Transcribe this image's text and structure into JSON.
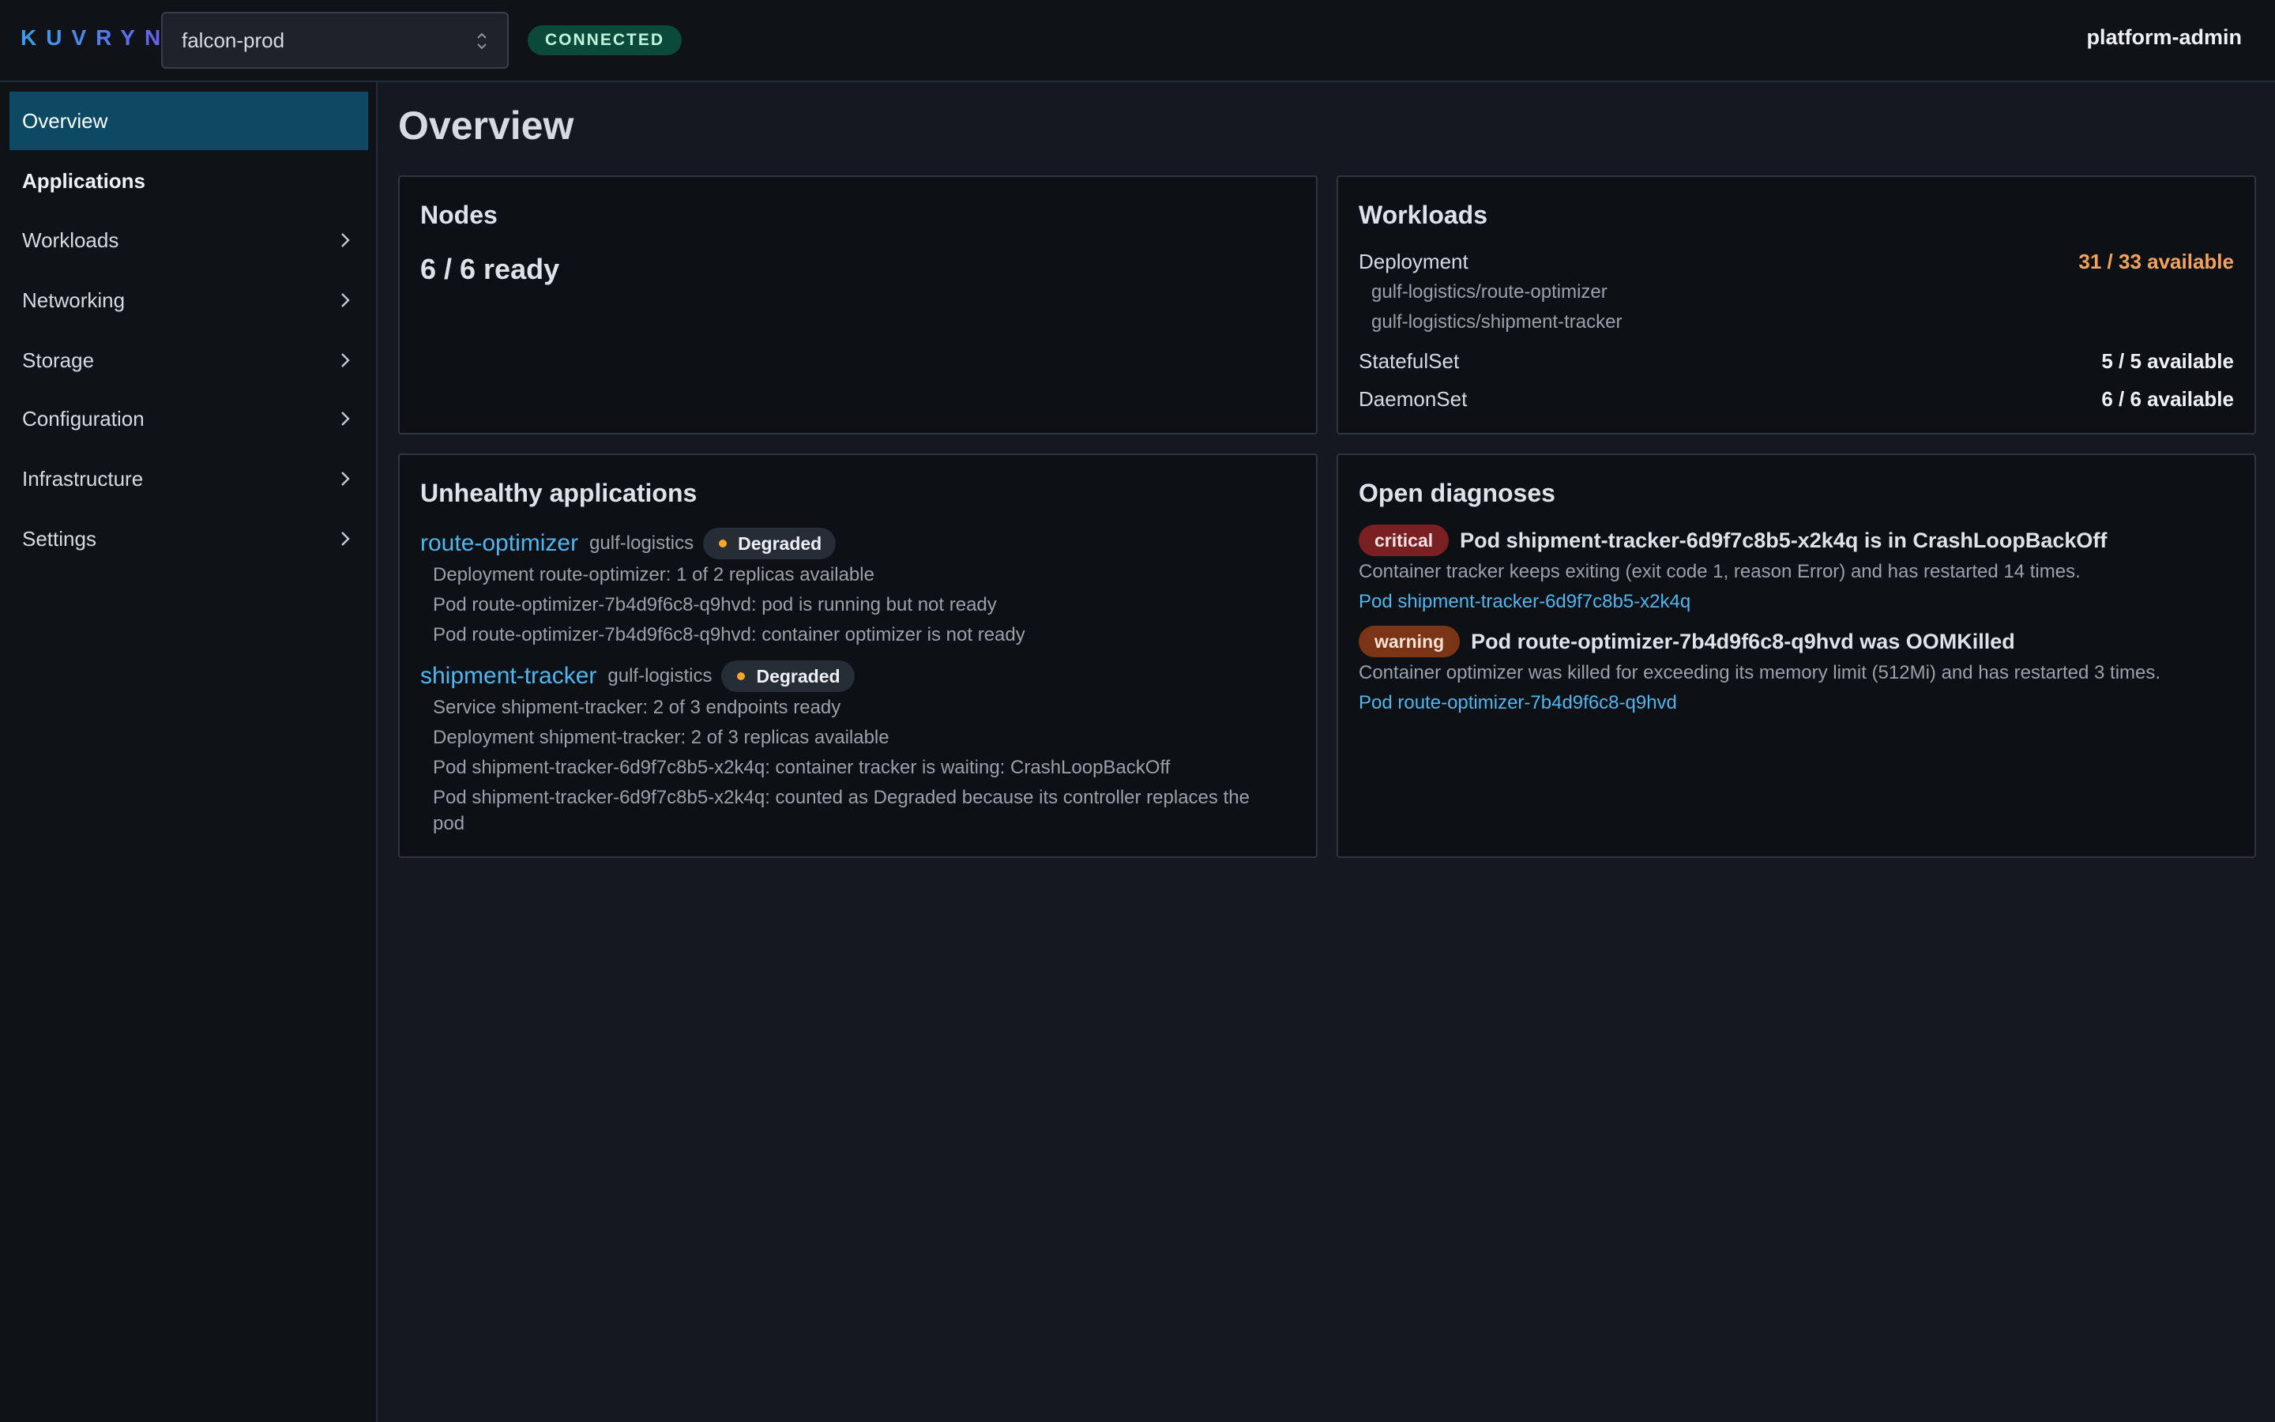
{
  "header": {
    "logo": "KUVRYN",
    "cluster": "falcon-prod",
    "status": "CONNECTED",
    "user": "platform-admin"
  },
  "sidebar": {
    "items": [
      {
        "label": "Overview"
      },
      {
        "label": "Applications"
      },
      {
        "label": "Workloads"
      },
      {
        "label": "Networking"
      },
      {
        "label": "Storage"
      },
      {
        "label": "Configuration"
      },
      {
        "label": "Infrastructure"
      },
      {
        "label": "Settings"
      }
    ]
  },
  "main": {
    "title": "Overview",
    "nodes": {
      "title": "Nodes",
      "stat": "6 / 6 ready"
    },
    "workloads": {
      "title": "Workloads",
      "rows": [
        {
          "kind": "Deployment",
          "value": "31 / 33 available"
        },
        {
          "kind": "StatefulSet",
          "value": "5 / 5 available"
        },
        {
          "kind": "DaemonSet",
          "value": "6 / 6 available"
        }
      ],
      "deployment_subs": [
        "gulf-logistics/route-optimizer",
        "gulf-logistics/shipment-tracker"
      ]
    },
    "unhealthy": {
      "title": "Unhealthy applications",
      "apps": [
        {
          "name": "route-optimizer",
          "namespace": "gulf-logistics",
          "status": "Degraded",
          "messages": [
            "Deployment route-optimizer: 1 of 2 replicas available",
            "Pod route-optimizer-7b4d9f6c8-q9hvd: pod is running but not ready",
            "Pod route-optimizer-7b4d9f6c8-q9hvd: container optimizer is not ready"
          ]
        },
        {
          "name": "shipment-tracker",
          "namespace": "gulf-logistics",
          "status": "Degraded",
          "messages": [
            "Service shipment-tracker: 2 of 3 endpoints ready",
            "Deployment shipment-tracker: 2 of 3 replicas available",
            "Pod shipment-tracker-6d9f7c8b5-x2k4q: container tracker is waiting: CrashLoopBackOff",
            "Pod shipment-tracker-6d9f7c8b5-x2k4q: counted as Degraded because its controller replaces the pod"
          ]
        }
      ]
    },
    "diagnoses": {
      "title": "Open diagnoses",
      "items": [
        {
          "severity": "critical",
          "title": "Pod shipment-tracker-6d9f7c8b5-x2k4q is in CrashLoopBackOff",
          "description": "Container tracker keeps exiting (exit code 1, reason Error) and has restarted 14 times.",
          "link": "Pod shipment-tracker-6d9f7c8b5-x2k4q"
        },
        {
          "severity": "warning",
          "title": "Pod route-optimizer-7b4d9f6c8-q9hvd was OOMKilled",
          "description": "Container optimizer was killed for exceeding its memory limit (512Mi) and has restarted 3 times.",
          "link": "Pod route-optimizer-7b4d9f6c8-q9hvd"
        }
      ]
    }
  }
}
